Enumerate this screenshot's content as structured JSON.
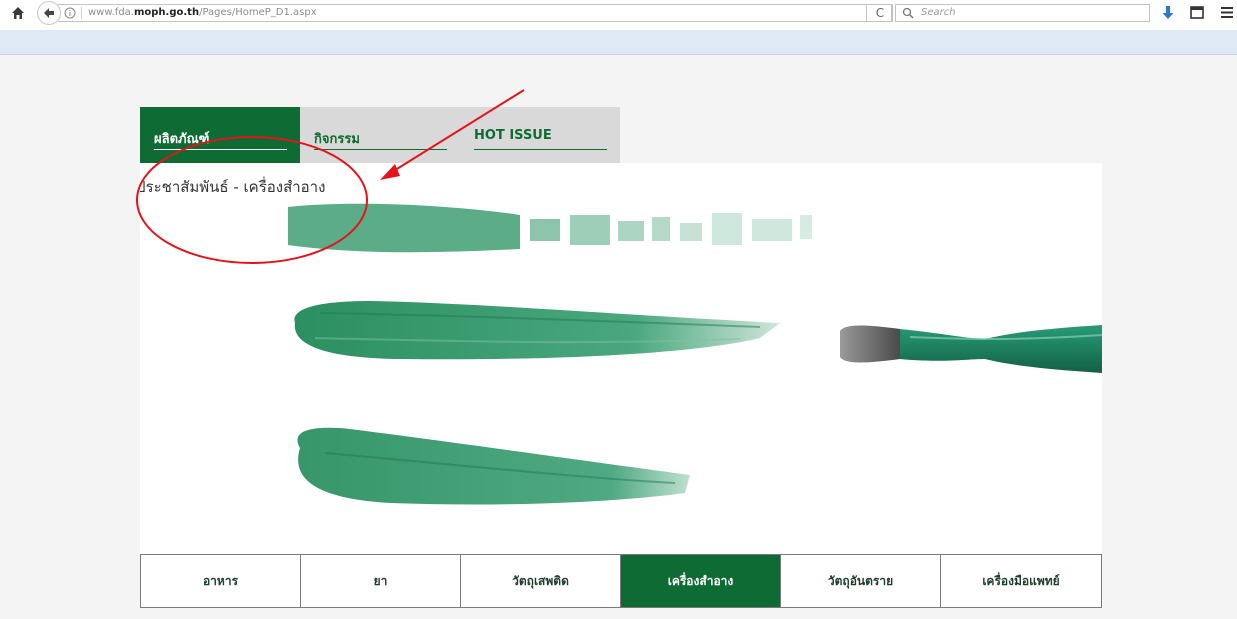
{
  "browser": {
    "url_prefix": "www.fda.",
    "url_domain": "moph.go.th",
    "url_path": "/Pages/HomeP_D1.aspx",
    "search_placeholder": "Search",
    "reload_glyph": "C"
  },
  "nav": {
    "tabs": [
      {
        "label": "ผลิตภัณฑ์",
        "active": true
      },
      {
        "label": "กิจกรรม",
        "active": false
      },
      {
        "label": "HOT ISSUE",
        "active": false
      }
    ]
  },
  "hero": {
    "title": "ประชาสัมพันธ์ - เครื่องสำอาง",
    "image": "green-nail-polish-brush-strokes"
  },
  "categories": [
    {
      "label": "อาหาร",
      "active": false
    },
    {
      "label": "ยา",
      "active": false
    },
    {
      "label": "วัตถุเสพติด",
      "active": false
    },
    {
      "label": "เครื่องสำอาง",
      "active": true
    },
    {
      "label": "วัตถุอันตราย",
      "active": false
    },
    {
      "label": "เครื่องมือแพทย์",
      "active": false
    }
  ],
  "colors": {
    "brand_green": "#0e6b33",
    "paint_green": "#2f9a6c",
    "annotation_red": "#e3141b"
  },
  "icons": [
    "home-icon",
    "back-arrow-icon",
    "info-icon",
    "reload-icon",
    "search-icon",
    "download-icon",
    "window-icon",
    "hamburger-menu-icon"
  ]
}
